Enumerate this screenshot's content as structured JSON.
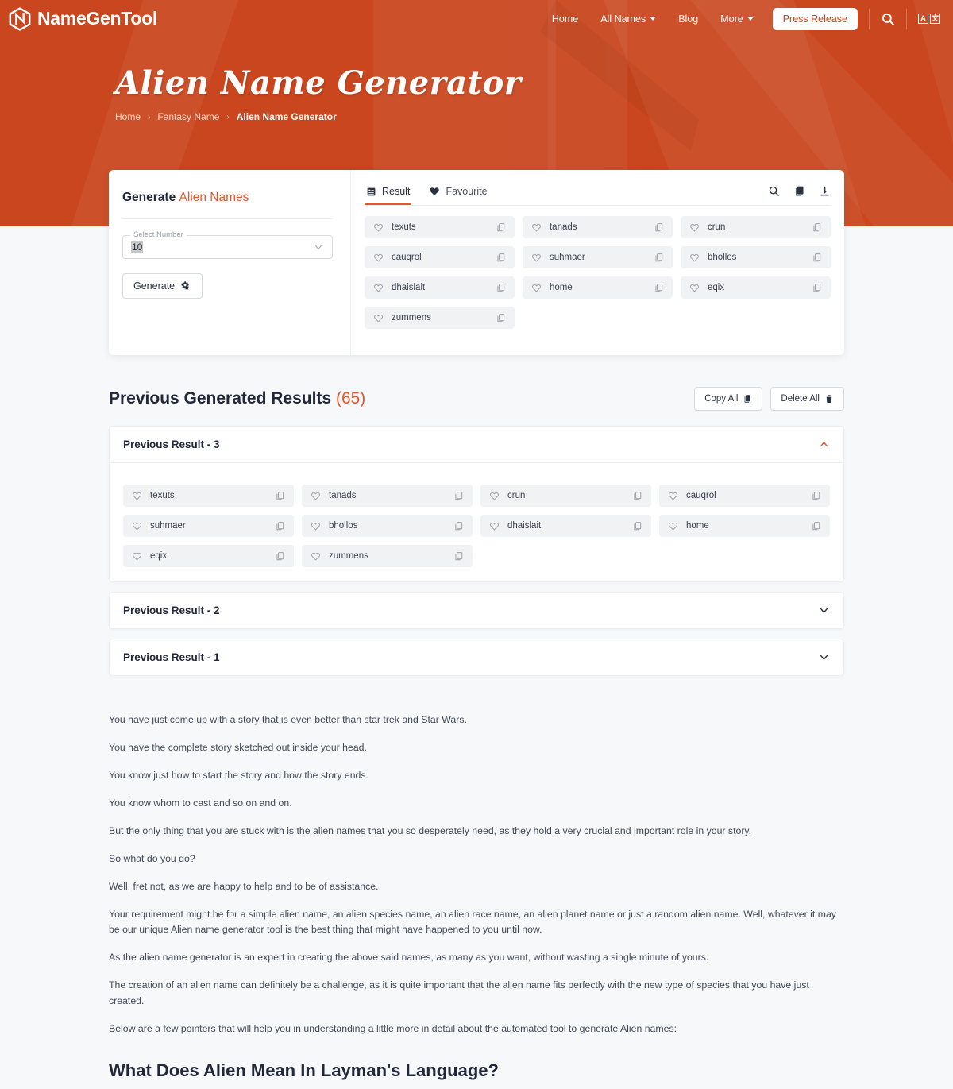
{
  "brand": {
    "name": "NameGenTool",
    "logo_icon": "hexagon-n-logo"
  },
  "nav": {
    "items": [
      {
        "label": "Home",
        "has_dropdown": false
      },
      {
        "label": "All Names",
        "has_dropdown": true
      },
      {
        "label": "Blog",
        "has_dropdown": false
      },
      {
        "label": "More",
        "has_dropdown": true
      }
    ],
    "press_release_label": "Press Release",
    "search_icon": "search-icon",
    "language_icon": "translate-icon",
    "language_glyphs": {
      "latin": "A",
      "cjk": "文"
    }
  },
  "hero": {
    "title": "Alien Name Generator",
    "breadcrumb": [
      {
        "label": "Home",
        "active": false
      },
      {
        "label": "Fantasy Name",
        "active": false
      },
      {
        "label": "Alien Name Generator",
        "active": true
      }
    ],
    "separator": "›",
    "bg_color": "#c9461e"
  },
  "generator": {
    "title_bold": "Generate",
    "title_accent": "Alien Names",
    "select_label": "Select Number",
    "select_value": "10",
    "chevron_icon": "chevron-down-icon",
    "generate_label": "Generate",
    "generate_icon": "cogs-icon"
  },
  "results_panel": {
    "tabs": [
      {
        "label": "Result",
        "icon": "list-result-icon",
        "active": true
      },
      {
        "label": "Favourite",
        "icon": "heart-filled-icon",
        "active": false
      }
    ],
    "actions": [
      {
        "icon": "search-icon",
        "name": "search-results"
      },
      {
        "icon": "copy-icon",
        "name": "copy-results"
      },
      {
        "icon": "download-icon",
        "name": "download-results"
      }
    ],
    "names": [
      "texuts",
      "tanads",
      "crun",
      "cauqrol",
      "suhmaer",
      "bhollos",
      "dhaislait",
      "home",
      "eqix",
      "zummens"
    ]
  },
  "previous": {
    "title": "Previous Generated Results",
    "count": "(65)",
    "copy_all_label": "Copy All",
    "copy_all_icon": "copy-icon",
    "delete_all_label": "Delete All",
    "delete_all_icon": "trash-icon",
    "accordions": [
      {
        "label": "Previous Result - 3",
        "expanded": true,
        "chevron_icon": "chevron-up-icon",
        "names": [
          "texuts",
          "tanads",
          "crun",
          "cauqrol",
          "suhmaer",
          "bhollos",
          "dhaislait",
          "home",
          "eqix",
          "zummens"
        ]
      },
      {
        "label": "Previous Result - 2",
        "expanded": false,
        "chevron_icon": "chevron-down-icon",
        "names": []
      },
      {
        "label": "Previous Result - 1",
        "expanded": false,
        "chevron_icon": "chevron-down-icon",
        "names": []
      }
    ]
  },
  "article": {
    "paragraphs": [
      "You have just come up with a story that is even better than star trek and Star Wars.",
      "You have the complete story sketched out inside your head.",
      "You know just how to start the story and how the story ends.",
      "You know whom to cast and so on and on.",
      "But the only thing that you are stuck with is the alien names that you so desperately need, as they hold a very crucial and important role in your story.",
      "So what do you do?",
      "Well, fret not, as we are happy to help and to be of assistance.",
      "Your requirement might be for a simple alien name, an alien species name, an alien race name, an alien planet name or just a random alien name. Well, whatever it may be our unique Alien name generator tool is the best thing that might have happened to you until now.",
      "As the alien name generator is an expert in creating the above said names, as many as you want, without wasting a single minute of yours.",
      "The creation of an alien name can definitely be a challenge, as it is quite important that the alien name fits perfectly with the new type of species that you have just created.",
      "Below are a few pointers that will help you in understanding a little more in detail about the automated tool to generate Alien names:"
    ],
    "heading": "What Does Alien Mean In Layman's Language?"
  },
  "colors": {
    "brand_orange": "#c9461e",
    "accent_orange": "#e4572e",
    "page_bg": "#f6f8fa",
    "chip_bg": "#f1f2f4"
  }
}
